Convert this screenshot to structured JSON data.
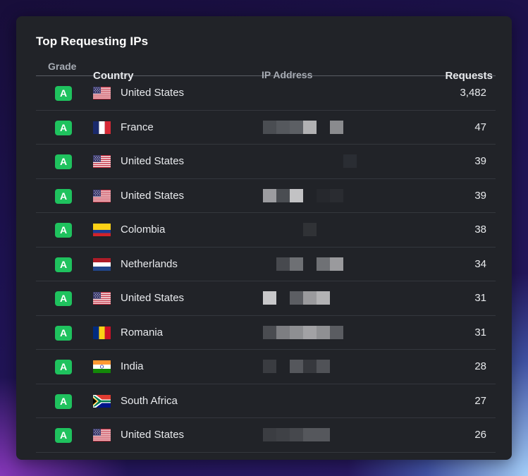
{
  "card": {
    "title": "Top Requesting IPs"
  },
  "columns": {
    "grade": "Grade",
    "country": "Country",
    "ip": "IP Address",
    "requests": "Requests"
  },
  "rows": [
    {
      "grade": "A",
      "flag": "us-flag-icon",
      "country": "United States",
      "requests": "3,482",
      "ip_redacted": [
        "#212328",
        "#212328",
        "#212328",
        "#212328",
        "#212328",
        "#212328",
        "#212328"
      ]
    },
    {
      "grade": "A",
      "flag": "fr-flag-icon",
      "country": "France",
      "requests": "47",
      "ip_redacted": [
        "#4a4d52",
        "#55585d",
        "#5c5f64",
        "#b1b1b3",
        "#212328",
        "#8a8b8e",
        "#212328"
      ]
    },
    {
      "grade": "A",
      "flag": "us-flag-icon",
      "country": "United States",
      "requests": "39",
      "ip_redacted": [
        "#212328",
        "#212328",
        "#212328",
        "#212328",
        "#212328",
        "#212328",
        "#2a2d33"
      ]
    },
    {
      "grade": "A",
      "flag": "us-flag-icon",
      "country": "United States",
      "requests": "39",
      "ip_redacted": [
        "#9c9ca0",
        "#4a4d52",
        "#c2c2c4",
        "#212328",
        "#26282d",
        "#2a2c31",
        "#212328"
      ]
    },
    {
      "grade": "A",
      "flag": "co-flag-icon",
      "country": "Colombia",
      "requests": "38",
      "ip_redacted": [
        "#212328",
        "#212328",
        "#212328",
        "#303236",
        "#212328",
        "#212328",
        "#212328"
      ]
    },
    {
      "grade": "A",
      "flag": "nl-flag-icon",
      "country": "Netherlands",
      "requests": "34",
      "ip_redacted": [
        "#212328",
        "#47494e",
        "#6e7074",
        "#212328",
        "#6f7175",
        "#9a9a9d",
        "#212328"
      ]
    },
    {
      "grade": "A",
      "flag": "us-flag-icon",
      "country": "United States",
      "requests": "31",
      "ip_redacted": [
        "#c8c8ca",
        "#212328",
        "#5c5e63",
        "#9a9a9d",
        "#b2b2b4",
        "#212328",
        "#212328"
      ]
    },
    {
      "grade": "A",
      "flag": "ro-flag-icon",
      "country": "Romania",
      "requests": "31",
      "ip_redacted": [
        "#4a4c51",
        "#7d7e82",
        "#8e8f92",
        "#a2a2a5",
        "#8f9093",
        "#5a5c61",
        "#212328"
      ]
    },
    {
      "grade": "A",
      "flag": "in-flag-icon",
      "country": "India",
      "requests": "28",
      "ip_redacted": [
        "#3a3c41",
        "#212328",
        "#55575c",
        "#36383d",
        "#505257",
        "#212328",
        "#212328"
      ]
    },
    {
      "grade": "A",
      "flag": "za-flag-icon",
      "country": "South Africa",
      "requests": "27",
      "ip_redacted": [
        "#212328",
        "#212328",
        "#212328",
        "#212328",
        "#212328",
        "#212328",
        "#212328"
      ]
    },
    {
      "grade": "A",
      "flag": "us-flag-icon",
      "country": "United States",
      "requests": "26",
      "ip_redacted": [
        "#3b3d42",
        "#3f4146",
        "#46484d",
        "#55575c",
        "#55575c",
        "#212328",
        "#212328"
      ]
    }
  ],
  "colors": {
    "card_bg": "#212328",
    "grade_badge": "#1fc25e",
    "header_text": "#a6abb3",
    "body_text": "#e8eaed"
  }
}
